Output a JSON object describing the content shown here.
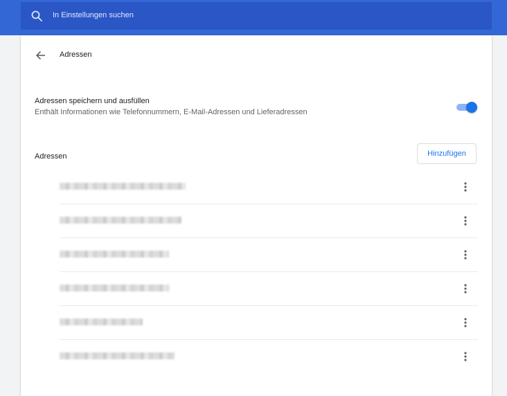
{
  "search": {
    "placeholder": "In Einstellungen suchen",
    "icon": "search-icon"
  },
  "header": {
    "back_icon": "arrow-back-icon",
    "title": "Adressen"
  },
  "setting": {
    "title": "Adressen speichern und ausfüllen",
    "description": "Enthält Informationen wie Telefonnummern, E-Mail-Adressen und Lieferadressen",
    "toggle_on": true
  },
  "addresses": {
    "label": "Adressen",
    "add_button": "Hinzufügen",
    "items": [
      {
        "text": "",
        "more_icon": "more-vert-icon"
      },
      {
        "text": "",
        "more_icon": "more-vert-icon"
      },
      {
        "text": "",
        "more_icon": "more-vert-icon"
      },
      {
        "text": "",
        "more_icon": "more-vert-icon"
      },
      {
        "text": "",
        "more_icon": "more-vert-icon"
      },
      {
        "text": "",
        "more_icon": "more-vert-icon"
      }
    ]
  },
  "colors": {
    "toolbar": "#3367d6",
    "search_box": "#2a56c6",
    "accent": "#1a73e8",
    "toggle_track": "#8ab4f8"
  }
}
